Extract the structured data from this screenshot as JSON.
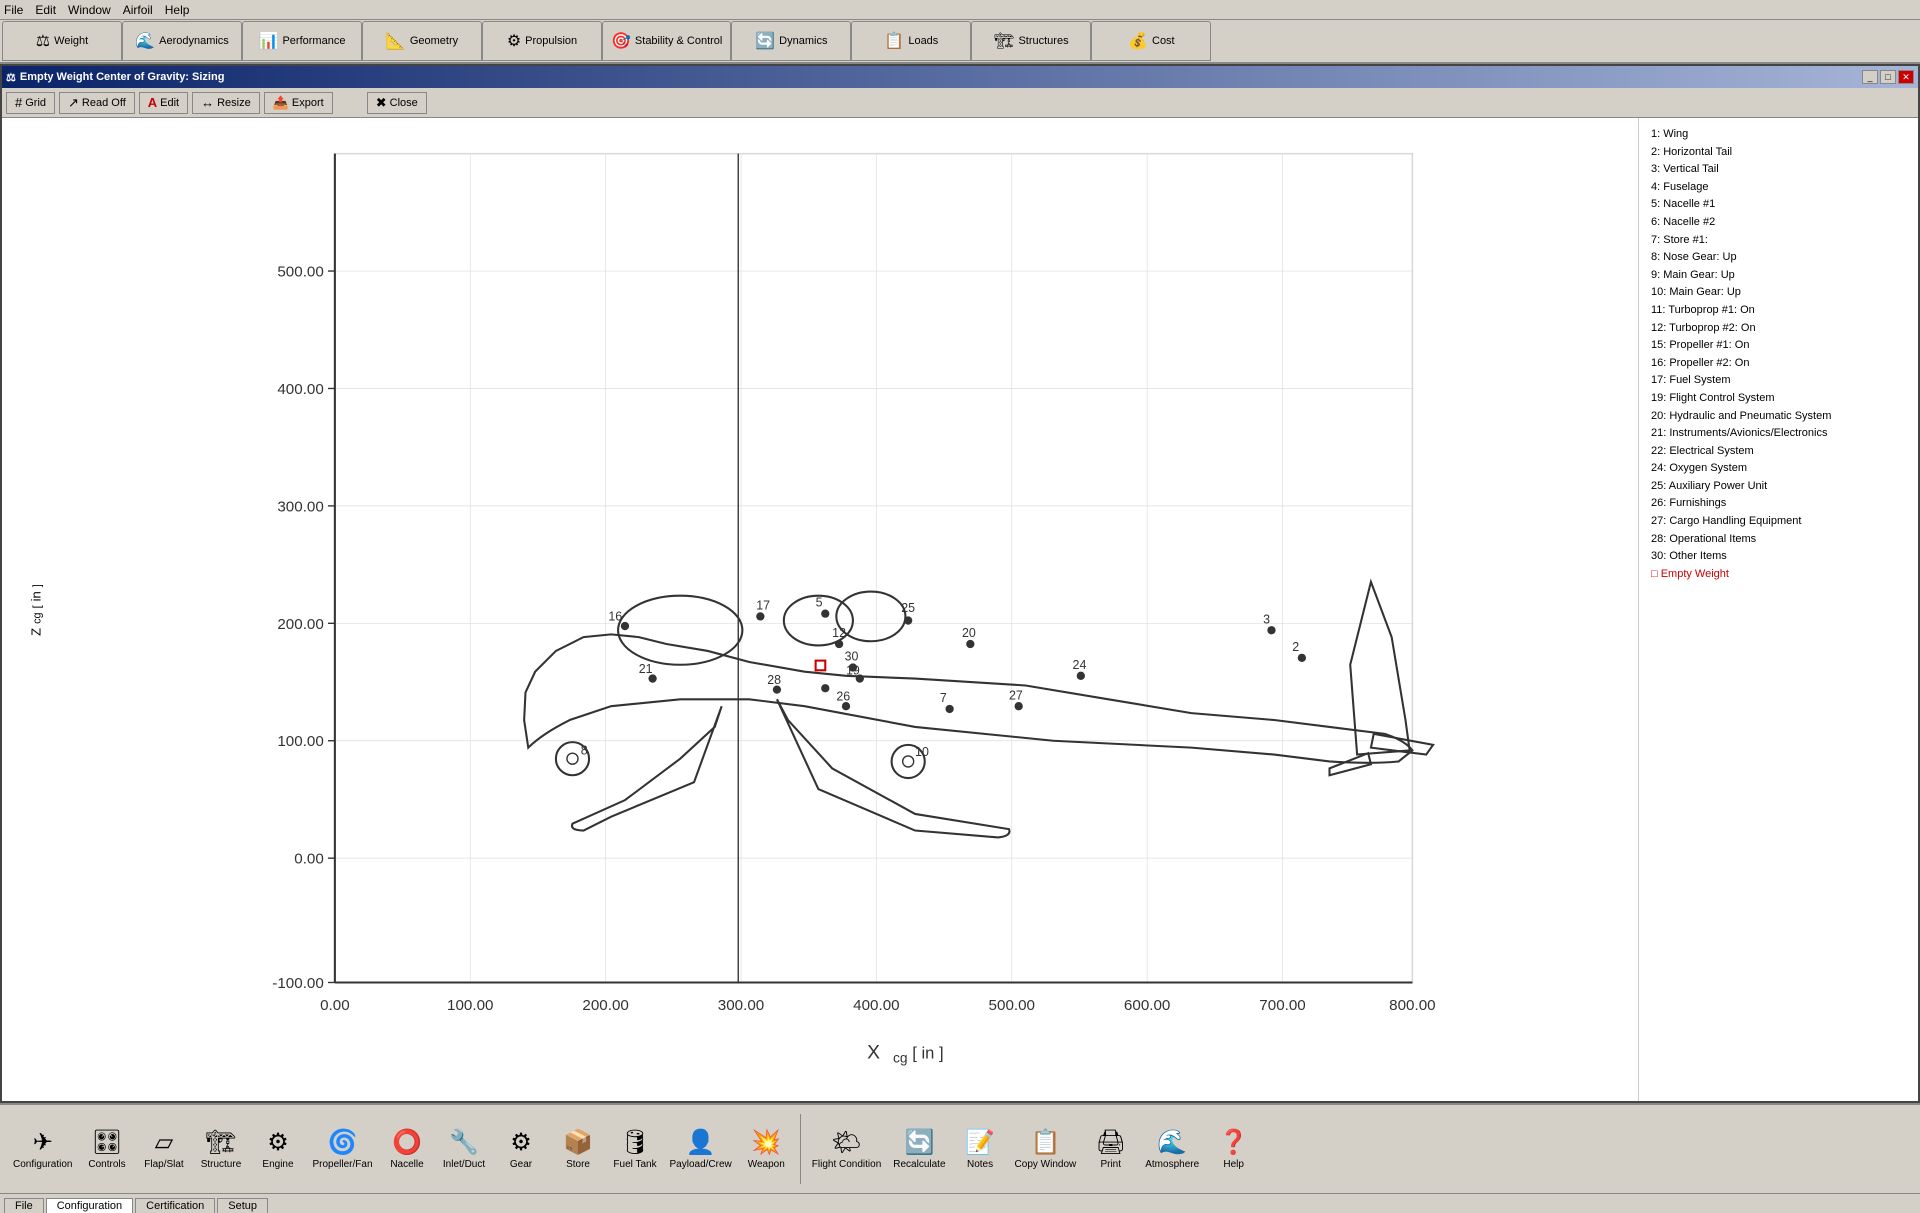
{
  "menu": {
    "items": [
      "File",
      "Edit",
      "Window",
      "Airfoil",
      "Help"
    ]
  },
  "tabs": [
    {
      "id": "weight",
      "label": "Weight",
      "icon": "⚖",
      "active": false
    },
    {
      "id": "aerodynamics",
      "label": "Aerodynamics",
      "icon": "✈",
      "active": false
    },
    {
      "id": "performance",
      "label": "Performance",
      "icon": "📊",
      "active": false
    },
    {
      "id": "geometry",
      "label": "Geometry",
      "icon": "📐",
      "active": false
    },
    {
      "id": "propulsion",
      "label": "Propulsion",
      "icon": "⚙",
      "active": false
    },
    {
      "id": "stability",
      "label": "Stability & Control",
      "icon": "🎯",
      "active": false
    },
    {
      "id": "dynamics",
      "label": "Dynamics",
      "icon": "🔄",
      "active": false
    },
    {
      "id": "loads",
      "label": "Loads",
      "icon": "📋",
      "active": false
    },
    {
      "id": "structures",
      "label": "Structures",
      "icon": "🏗",
      "active": false
    },
    {
      "id": "cost",
      "label": "Cost",
      "icon": "💰",
      "active": false
    }
  ],
  "window_title": "Empty Weight Center of Gravity: Sizing",
  "toolbar_buttons": [
    {
      "id": "grid",
      "label": "Grid",
      "icon": "#"
    },
    {
      "id": "readoff",
      "label": "Read Off",
      "icon": "↗"
    },
    {
      "id": "edit",
      "label": "Edit",
      "icon": "A"
    },
    {
      "id": "resize",
      "label": "Resize",
      "icon": "↔"
    },
    {
      "id": "export",
      "label": "Export",
      "icon": "📤"
    },
    {
      "id": "close",
      "label": "Close",
      "icon": "✖"
    }
  ],
  "chart": {
    "title": "Empty Weight Center of Gravity: Sizing",
    "x_label": "X",
    "x_unit": "in",
    "z_label": "Z",
    "z_unit": "in",
    "x_axis": {
      "min": 0,
      "max": 800,
      "ticks": [
        0,
        100,
        200,
        300,
        400,
        500,
        600,
        700,
        800
      ]
    },
    "z_axis": {
      "min": -100,
      "max": 500,
      "ticks": [
        -100,
        0,
        100,
        200,
        300,
        400,
        500
      ]
    },
    "subscript_cg": "cg"
  },
  "legend": {
    "items": [
      "1: Wing",
      "2: Horizontal Tail",
      "3: Vertical Tail",
      "4: Fuselage",
      "5: Nacelle #1",
      "6: Nacelle #2",
      "7: Store #1:",
      "8: Nose Gear: Up",
      "9: Main Gear: Up",
      "10: Main Gear: Up",
      "11: Turboprop #1: On",
      "12: Turboprop #2: On",
      "15: Propeller #1: On",
      "16: Propeller #2: On",
      "17: Fuel System",
      "19: Flight Control System",
      "20: Hydraulic and Pneumatic System",
      "21: Instruments/Avionics/Electronics",
      "22: Electrical System",
      "24: Oxygen System",
      "25: Auxiliary Power Unit",
      "26: Furnishings",
      "27: Cargo Handling Equipment",
      "28: Operational Items",
      "30: Other Items",
      "□ Empty Weight"
    ]
  },
  "bottom_tools": [
    {
      "id": "configuration",
      "label": "Configuration",
      "icon": "✈"
    },
    {
      "id": "controls",
      "label": "Controls",
      "icon": "🎛"
    },
    {
      "id": "flap-slat",
      "label": "Flap/Slat",
      "icon": "▱"
    },
    {
      "id": "structure",
      "label": "Structure",
      "icon": "🏗"
    },
    {
      "id": "engine",
      "label": "Engine",
      "icon": "⚙"
    },
    {
      "id": "propeller-fan",
      "label": "Propeller/Fan",
      "icon": "🌀"
    },
    {
      "id": "nacelle",
      "label": "Nacelle",
      "icon": "⭕"
    },
    {
      "id": "inlet-duct",
      "label": "Inlet/Duct",
      "icon": "🔧"
    },
    {
      "id": "gear",
      "label": "Gear",
      "icon": "⚙"
    },
    {
      "id": "store",
      "label": "Store",
      "icon": "📦"
    },
    {
      "id": "fuel-tank",
      "label": "Fuel Tank",
      "icon": "🛢"
    },
    {
      "id": "payload-crew",
      "label": "Payload/Crew",
      "icon": "👤"
    },
    {
      "id": "weapon",
      "label": "Weapon",
      "icon": "💥"
    },
    {
      "id": "flight-condition",
      "label": "Flight Condition",
      "icon": "🌤"
    },
    {
      "id": "recalculate",
      "label": "Recalculate",
      "icon": "🔄"
    },
    {
      "id": "notes",
      "label": "Notes",
      "icon": "📝"
    },
    {
      "id": "copy-window",
      "label": "Copy Window",
      "icon": "📋"
    },
    {
      "id": "print",
      "label": "Print",
      "icon": "🖨"
    },
    {
      "id": "atmosphere",
      "label": "Atmosphere",
      "icon": "🌊"
    },
    {
      "id": "help",
      "label": "Help",
      "icon": "❓"
    }
  ],
  "bottom_tabs": [
    {
      "id": "file",
      "label": "File"
    },
    {
      "id": "configuration",
      "label": "Configuration",
      "active": true
    },
    {
      "id": "certification",
      "label": "Certification"
    },
    {
      "id": "setup",
      "label": "Setup"
    }
  ]
}
